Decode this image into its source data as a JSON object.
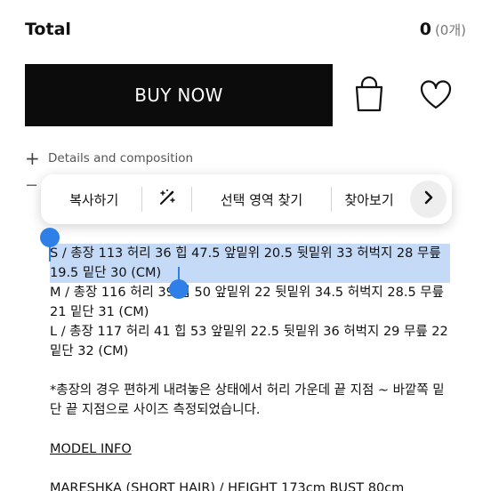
{
  "total": {
    "label": "Total",
    "value": "0",
    "count": "(0개)"
  },
  "actions": {
    "buy_label": "BUY NOW",
    "bag_icon": "shopping-bag-icon",
    "wishlist_icon": "heart-icon"
  },
  "details": {
    "label": "Details and composition"
  },
  "context_menu": {
    "copy": "복사하기",
    "magic_icon": "sparkle-icon",
    "find_selection": "선택 영역 찾기",
    "search": "찾아보기",
    "next_icon": "chevron-right-icon"
  },
  "size_info": {
    "s_selected": "S / 총장 113 허리 36 힙 47.5 앞밑위 20.5 뒷밑위 33 허벅지 28 무릎 19.5 밑단 30 (CM)",
    "m": "M / 총장 116 허리 39 힙 50 앞밑위 22 뒷밑위 34.5 허벅지 28.5 무릎 21 밑단 31 (CM)",
    "l": "L / 총장 117 허리 41 힙 53 앞밑위 22.5 뒷밑위 36 허벅지 29 무릎 22 밑단 32 (CM)",
    "note": "*총장의 경우 편하게 내려놓은 상태에서 허리 가운데 끝 지점 ~ 바깥쪽 밑단 끝 지점으로 사이즈 측정되었습니다."
  },
  "model": {
    "title": "MODEL INFO",
    "line": "MARESHKA (SHORT HAIR) / HEIGHT 173cm BUST 80cm"
  },
  "colors": {
    "button_bg": "#0c0c0c",
    "selection": "#5894e6",
    "handle": "#2f7fe8"
  }
}
